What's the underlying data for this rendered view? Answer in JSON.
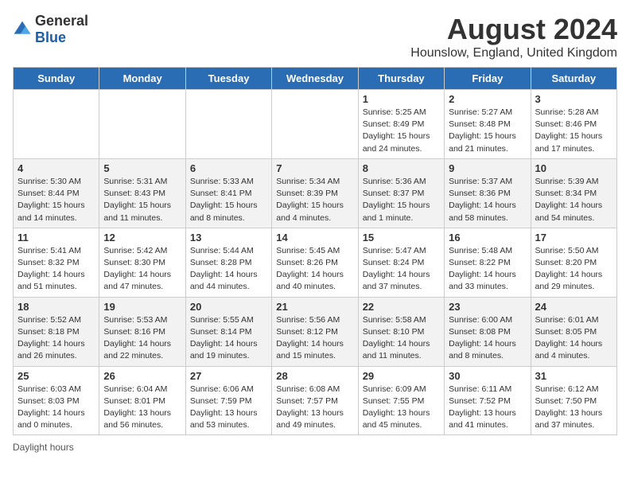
{
  "logo": {
    "general": "General",
    "blue": "Blue"
  },
  "title": "August 2024",
  "subtitle": "Hounslow, England, United Kingdom",
  "days_of_week": [
    "Sunday",
    "Monday",
    "Tuesday",
    "Wednesday",
    "Thursday",
    "Friday",
    "Saturday"
  ],
  "weeks": [
    [
      {
        "day": "",
        "info": ""
      },
      {
        "day": "",
        "info": ""
      },
      {
        "day": "",
        "info": ""
      },
      {
        "day": "",
        "info": ""
      },
      {
        "day": "1",
        "info": "Sunrise: 5:25 AM\nSunset: 8:49 PM\nDaylight: 15 hours and 24 minutes."
      },
      {
        "day": "2",
        "info": "Sunrise: 5:27 AM\nSunset: 8:48 PM\nDaylight: 15 hours and 21 minutes."
      },
      {
        "day": "3",
        "info": "Sunrise: 5:28 AM\nSunset: 8:46 PM\nDaylight: 15 hours and 17 minutes."
      }
    ],
    [
      {
        "day": "4",
        "info": "Sunrise: 5:30 AM\nSunset: 8:44 PM\nDaylight: 15 hours and 14 minutes."
      },
      {
        "day": "5",
        "info": "Sunrise: 5:31 AM\nSunset: 8:43 PM\nDaylight: 15 hours and 11 minutes."
      },
      {
        "day": "6",
        "info": "Sunrise: 5:33 AM\nSunset: 8:41 PM\nDaylight: 15 hours and 8 minutes."
      },
      {
        "day": "7",
        "info": "Sunrise: 5:34 AM\nSunset: 8:39 PM\nDaylight: 15 hours and 4 minutes."
      },
      {
        "day": "8",
        "info": "Sunrise: 5:36 AM\nSunset: 8:37 PM\nDaylight: 15 hours and 1 minute."
      },
      {
        "day": "9",
        "info": "Sunrise: 5:37 AM\nSunset: 8:36 PM\nDaylight: 14 hours and 58 minutes."
      },
      {
        "day": "10",
        "info": "Sunrise: 5:39 AM\nSunset: 8:34 PM\nDaylight: 14 hours and 54 minutes."
      }
    ],
    [
      {
        "day": "11",
        "info": "Sunrise: 5:41 AM\nSunset: 8:32 PM\nDaylight: 14 hours and 51 minutes."
      },
      {
        "day": "12",
        "info": "Sunrise: 5:42 AM\nSunset: 8:30 PM\nDaylight: 14 hours and 47 minutes."
      },
      {
        "day": "13",
        "info": "Sunrise: 5:44 AM\nSunset: 8:28 PM\nDaylight: 14 hours and 44 minutes."
      },
      {
        "day": "14",
        "info": "Sunrise: 5:45 AM\nSunset: 8:26 PM\nDaylight: 14 hours and 40 minutes."
      },
      {
        "day": "15",
        "info": "Sunrise: 5:47 AM\nSunset: 8:24 PM\nDaylight: 14 hours and 37 minutes."
      },
      {
        "day": "16",
        "info": "Sunrise: 5:48 AM\nSunset: 8:22 PM\nDaylight: 14 hours and 33 minutes."
      },
      {
        "day": "17",
        "info": "Sunrise: 5:50 AM\nSunset: 8:20 PM\nDaylight: 14 hours and 29 minutes."
      }
    ],
    [
      {
        "day": "18",
        "info": "Sunrise: 5:52 AM\nSunset: 8:18 PM\nDaylight: 14 hours and 26 minutes."
      },
      {
        "day": "19",
        "info": "Sunrise: 5:53 AM\nSunset: 8:16 PM\nDaylight: 14 hours and 22 minutes."
      },
      {
        "day": "20",
        "info": "Sunrise: 5:55 AM\nSunset: 8:14 PM\nDaylight: 14 hours and 19 minutes."
      },
      {
        "day": "21",
        "info": "Sunrise: 5:56 AM\nSunset: 8:12 PM\nDaylight: 14 hours and 15 minutes."
      },
      {
        "day": "22",
        "info": "Sunrise: 5:58 AM\nSunset: 8:10 PM\nDaylight: 14 hours and 11 minutes."
      },
      {
        "day": "23",
        "info": "Sunrise: 6:00 AM\nSunset: 8:08 PM\nDaylight: 14 hours and 8 minutes."
      },
      {
        "day": "24",
        "info": "Sunrise: 6:01 AM\nSunset: 8:05 PM\nDaylight: 14 hours and 4 minutes."
      }
    ],
    [
      {
        "day": "25",
        "info": "Sunrise: 6:03 AM\nSunset: 8:03 PM\nDaylight: 14 hours and 0 minutes."
      },
      {
        "day": "26",
        "info": "Sunrise: 6:04 AM\nSunset: 8:01 PM\nDaylight: 13 hours and 56 minutes."
      },
      {
        "day": "27",
        "info": "Sunrise: 6:06 AM\nSunset: 7:59 PM\nDaylight: 13 hours and 53 minutes."
      },
      {
        "day": "28",
        "info": "Sunrise: 6:08 AM\nSunset: 7:57 PM\nDaylight: 13 hours and 49 minutes."
      },
      {
        "day": "29",
        "info": "Sunrise: 6:09 AM\nSunset: 7:55 PM\nDaylight: 13 hours and 45 minutes."
      },
      {
        "day": "30",
        "info": "Sunrise: 6:11 AM\nSunset: 7:52 PM\nDaylight: 13 hours and 41 minutes."
      },
      {
        "day": "31",
        "info": "Sunrise: 6:12 AM\nSunset: 7:50 PM\nDaylight: 13 hours and 37 minutes."
      }
    ]
  ],
  "footer": "Daylight hours"
}
